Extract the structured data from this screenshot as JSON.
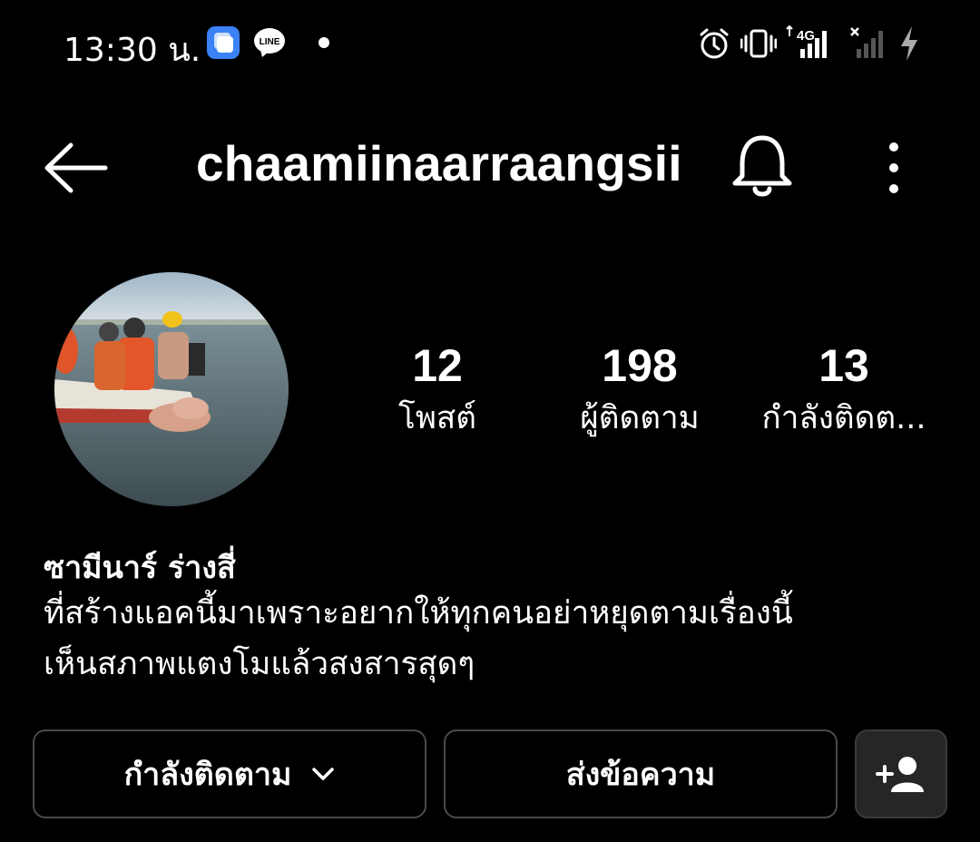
{
  "status_bar": {
    "time": "13:30 น.",
    "left_icons": [
      "app-icon",
      "line-icon",
      "dot-icon"
    ],
    "right_icons": [
      "alarm-icon",
      "vibrate-icon",
      "signal-4g-icon",
      "signal-no-sim-icon",
      "charging-icon"
    ],
    "network_label": "4G",
    "line_label": "LINE"
  },
  "header": {
    "username": "chaamiinaarraangsii"
  },
  "profile": {
    "avatar_icon": "profile-photo",
    "stats": {
      "posts": {
        "count": "12",
        "label": "โพสต์"
      },
      "followers": {
        "count": "198",
        "label": "ผู้ติดตาม"
      },
      "following": {
        "count": "13",
        "label": "กำลังติดต..."
      }
    },
    "display_name": "ซามีนาร์ ร่างสี่",
    "bio_lines": [
      "ที่สร้างแอคนี้มาเพราะอยากให้ทุกคนอย่าหยุดตามเรื่องนี้",
      "เห็นสภาพแตงโมแล้วสงสารสุดๆ"
    ]
  },
  "actions": {
    "following_label": "กำลังติดตาม",
    "message_label": "ส่งข้อความ",
    "add_icon": "person-add-icon"
  },
  "colors": {
    "background": "#000000",
    "text": "#ffffff",
    "button_border": "#4a4a4a",
    "add_button_bg": "#262626"
  }
}
